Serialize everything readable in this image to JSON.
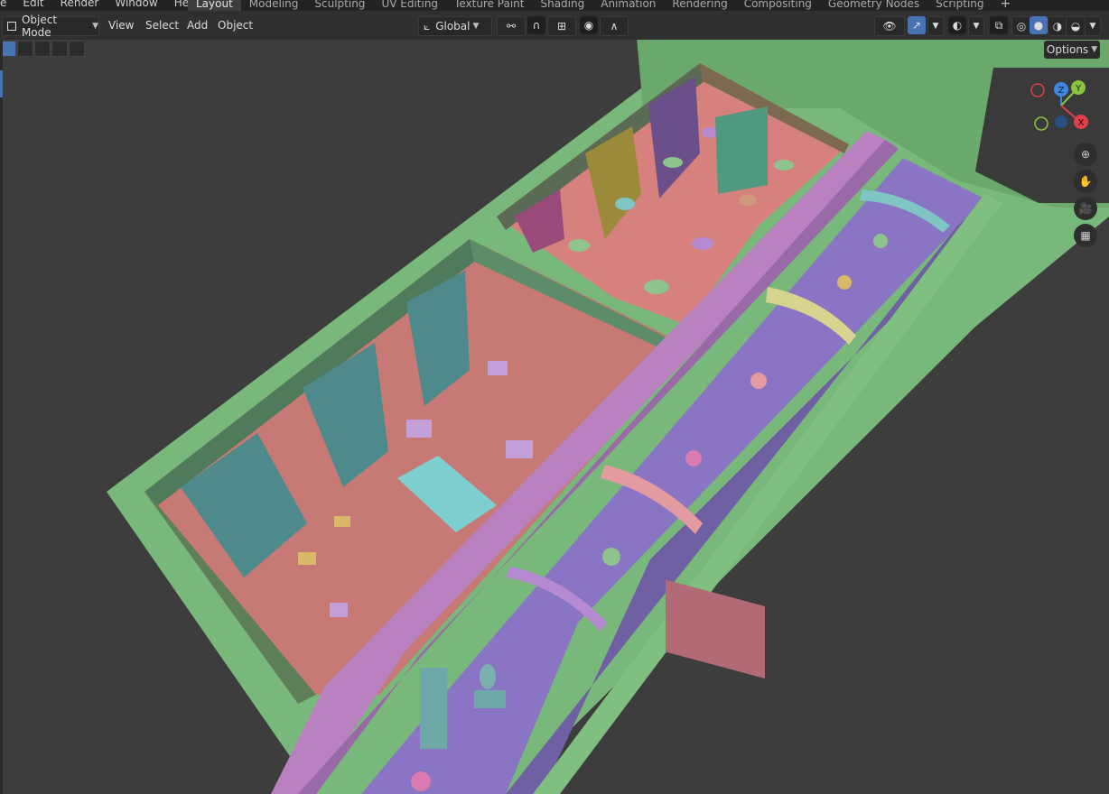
{
  "menu": {
    "items": [
      "e",
      "Edit",
      "Render",
      "Window",
      "Help"
    ]
  },
  "workspaces": {
    "tabs": [
      "Layout",
      "Modeling",
      "Sculpting",
      "UV Editing",
      "Texture Paint",
      "Shading",
      "Animation",
      "Rendering",
      "Compositing",
      "Geometry Nodes",
      "Scripting"
    ],
    "active": "Layout",
    "add": "+"
  },
  "header": {
    "mode": "Object Mode",
    "view": "View",
    "select": "Select",
    "add": "Add",
    "object": "Object",
    "transform_orientation": "Global",
    "options": "Options"
  },
  "gizmo": {
    "z": "Z",
    "y": "Y",
    "x": "X"
  },
  "colors": {
    "accent": "#4772b3",
    "wall_green": "#7fbf7f",
    "room_pink": "#d8837f",
    "corridor_lilac": "#8a74c4",
    "wall_magenta": "#b981c0",
    "prop_teal": "#6fb7b7",
    "axis_x": "#e0404a",
    "axis_y": "#8bc43f",
    "axis_z": "#3f86e4"
  }
}
